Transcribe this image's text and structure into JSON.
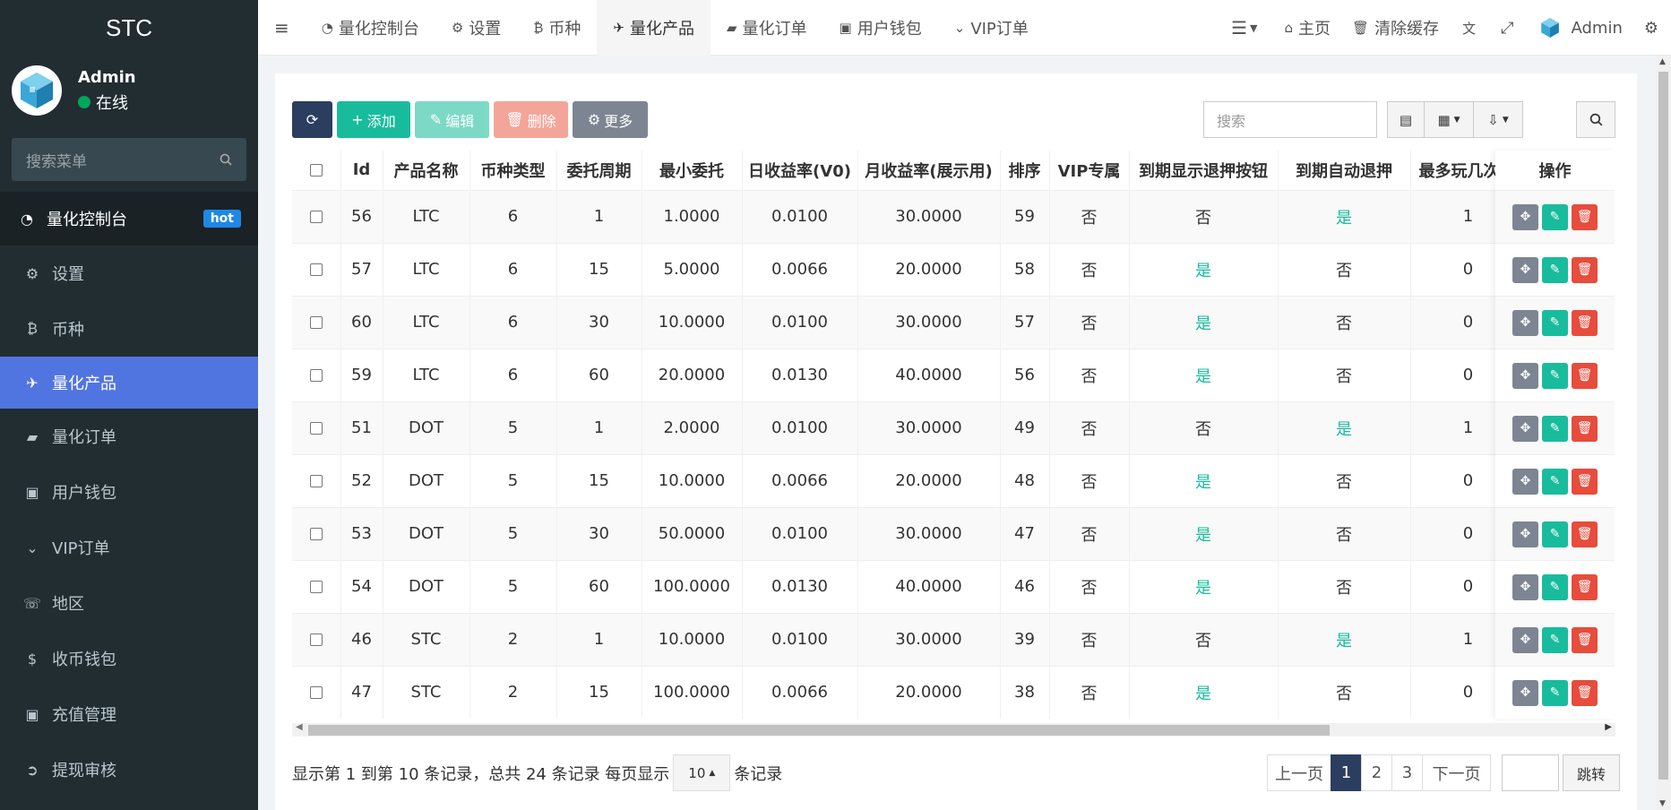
{
  "app": {
    "logo": "STC"
  },
  "user": {
    "name": "Admin",
    "status": "在线"
  },
  "sidebar": {
    "search_placeholder": "搜索菜单",
    "items": [
      {
        "label": "量化控制台",
        "icon": "dashboard-icon",
        "badge": "hot"
      },
      {
        "label": "设置",
        "icon": "gear-icon"
      },
      {
        "label": "币种",
        "icon": "bitcoin-icon"
      },
      {
        "label": "量化产品",
        "icon": "plane-icon"
      },
      {
        "label": "量化订单",
        "icon": "book-icon"
      },
      {
        "label": "用户钱包",
        "icon": "money-icon"
      },
      {
        "label": "VIP订单",
        "icon": "chevron-circle-icon"
      },
      {
        "label": "地区",
        "icon": "phone-icon"
      },
      {
        "label": "收币钱包",
        "icon": "dollar-icon"
      },
      {
        "label": "充值管理",
        "icon": "money-icon"
      },
      {
        "label": "提现审核",
        "icon": "arrow-circle-icon"
      }
    ]
  },
  "topnav": {
    "tabs": [
      {
        "label": "量化控制台",
        "icon": "dashboard-icon"
      },
      {
        "label": "设置",
        "icon": "gear-icon"
      },
      {
        "label": "币种",
        "icon": "bitcoin-icon"
      },
      {
        "label": "量化产品",
        "icon": "plane-icon"
      },
      {
        "label": "量化订单",
        "icon": "book-icon"
      },
      {
        "label": "用户钱包",
        "icon": "money-icon"
      },
      {
        "label": "VIP订单",
        "icon": "chevron-circle-icon"
      }
    ],
    "home": "主页",
    "clear_cache": "清除缓存",
    "admin": "Admin"
  },
  "toolbar": {
    "add": "添加",
    "edit": "编辑",
    "delete": "删除",
    "more": "更多",
    "search_placeholder": "搜索"
  },
  "table": {
    "columns": [
      "Id",
      "产品名称",
      "币种类型",
      "委托周期",
      "最小委托",
      "日收益率(V0)",
      "月收益率(展示用)",
      "排序",
      "VIP专属",
      "到期显示退押按钮",
      "到期自动退押",
      "最多玩几次",
      "操作"
    ],
    "rows": [
      [
        "56",
        "LTC",
        "6",
        "1",
        "1.0000",
        "0.0100",
        "30.0000",
        "59",
        "否",
        "否",
        "是",
        "1"
      ],
      [
        "57",
        "LTC",
        "6",
        "15",
        "5.0000",
        "0.0066",
        "20.0000",
        "58",
        "否",
        "是",
        "否",
        "0"
      ],
      [
        "60",
        "LTC",
        "6",
        "30",
        "10.0000",
        "0.0100",
        "30.0000",
        "57",
        "否",
        "是",
        "否",
        "0"
      ],
      [
        "59",
        "LTC",
        "6",
        "60",
        "20.0000",
        "0.0130",
        "40.0000",
        "56",
        "否",
        "是",
        "否",
        "0"
      ],
      [
        "51",
        "DOT",
        "5",
        "1",
        "2.0000",
        "0.0100",
        "30.0000",
        "49",
        "否",
        "否",
        "是",
        "1"
      ],
      [
        "52",
        "DOT",
        "5",
        "15",
        "10.0000",
        "0.0066",
        "20.0000",
        "48",
        "否",
        "是",
        "否",
        "0"
      ],
      [
        "53",
        "DOT",
        "5",
        "30",
        "50.0000",
        "0.0100",
        "30.0000",
        "47",
        "否",
        "是",
        "否",
        "0"
      ],
      [
        "54",
        "DOT",
        "5",
        "60",
        "100.0000",
        "0.0130",
        "40.0000",
        "46",
        "否",
        "是",
        "否",
        "0"
      ],
      [
        "46",
        "STC",
        "2",
        "1",
        "10.0000",
        "0.0100",
        "30.0000",
        "39",
        "否",
        "否",
        "是",
        "1"
      ],
      [
        "47",
        "STC",
        "2",
        "15",
        "100.0000",
        "0.0066",
        "20.0000",
        "38",
        "否",
        "是",
        "否",
        "0"
      ]
    ]
  },
  "pager": {
    "info_prefix": "显示第 1 到第 10 条记录，总共 24 条记录 每页显示",
    "page_size": "10",
    "info_suffix": "条记录",
    "prev": "上一页",
    "pages": [
      "1",
      "2",
      "3"
    ],
    "next": "下一页",
    "jump": "跳转"
  },
  "colors": {
    "sidebar": "#222d32",
    "active": "#5175e0",
    "accent": "#18bc9c",
    "danger": "#e74c3c",
    "primary": "#2c3e60"
  }
}
